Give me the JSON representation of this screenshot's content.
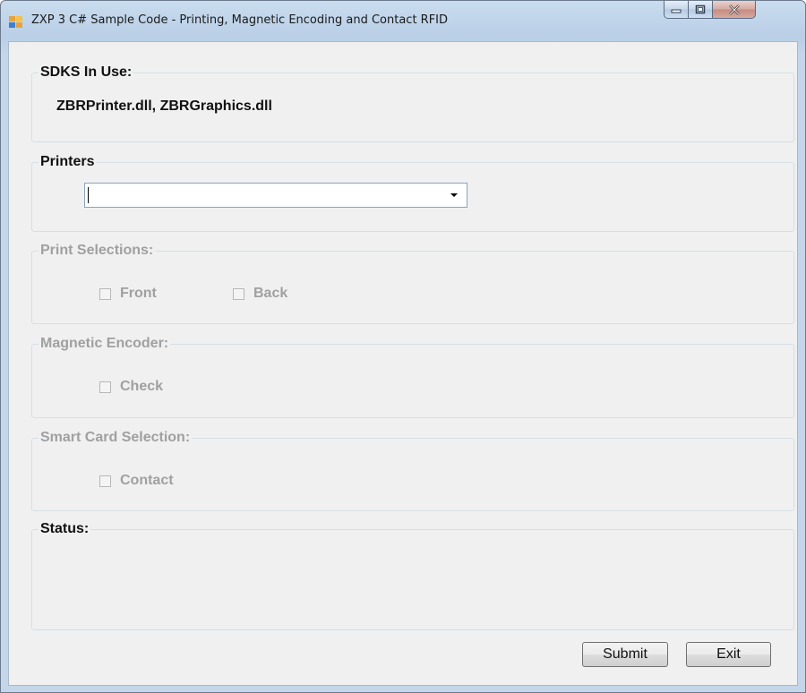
{
  "window": {
    "title": "ZXP 3 C# Sample Code - Printing, Magnetic Encoding and Contact RFID"
  },
  "caption_buttons": {
    "minimize_icon": "minimize-icon",
    "maximize_icon": "maximize-icon",
    "close_icon": "close-icon"
  },
  "sdks": {
    "label": "SDKS In Use:",
    "value": "ZBRPrinter.dll, ZBRGraphics.dll"
  },
  "printers": {
    "label": "Printers",
    "selected": ""
  },
  "print_selections": {
    "label": "Print Selections:",
    "options": [
      {
        "label": "Front",
        "checked": false
      },
      {
        "label": "Back",
        "checked": false
      }
    ]
  },
  "magnetic_encoder": {
    "label": "Magnetic Encoder:",
    "options": [
      {
        "label": "Check",
        "checked": false
      }
    ]
  },
  "smart_card": {
    "label": "Smart Card Selection:",
    "options": [
      {
        "label": "Contact",
        "checked": false
      }
    ]
  },
  "status": {
    "label": "Status:",
    "text": ""
  },
  "buttons": {
    "submit": "Submit",
    "exit": "Exit"
  },
  "colors": {
    "disabled_text": "#a0a0a0",
    "form_background": "#f0f0f0"
  }
}
